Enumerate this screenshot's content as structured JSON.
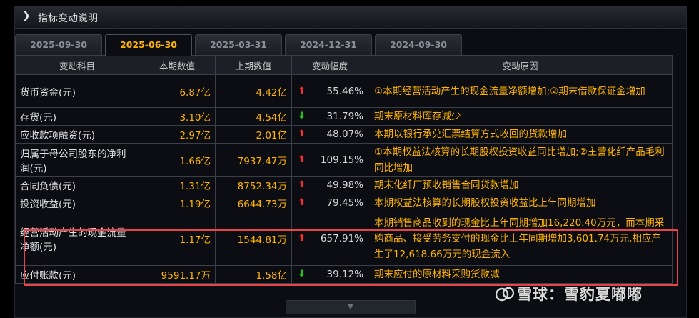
{
  "header": {
    "title": "指标变动说明"
  },
  "tabs": [
    {
      "label": "2025-09-30",
      "active": false
    },
    {
      "label": "2025-06-30",
      "active": true
    },
    {
      "label": "2025-03-31",
      "active": false
    },
    {
      "label": "2024-12-31",
      "active": false
    },
    {
      "label": "2024-09-30",
      "active": false
    }
  ],
  "columns": [
    "变动科目",
    "本期数值",
    "上期数值",
    "变动幅度",
    "变动原因"
  ],
  "rows": [
    {
      "item": "货币资金(元)",
      "cur_val": "6.87",
      "cur_unit": "亿",
      "prev_val": "4.42",
      "prev_unit": "亿",
      "change": "55.46%",
      "direction": "up",
      "reason": "①本期经营活动产生的现金流量净额增加;②期末借款保证金增加"
    },
    {
      "item": "存货(元)",
      "cur_val": "3.10",
      "cur_unit": "亿",
      "prev_val": "4.54",
      "prev_unit": "亿",
      "change": "31.79%",
      "direction": "down",
      "reason": "期末原材料库存减少"
    },
    {
      "item": "应收款项融资(元)",
      "cur_val": "2.97",
      "cur_unit": "亿",
      "prev_val": "2.01",
      "prev_unit": "亿",
      "change": "48.07%",
      "direction": "up",
      "reason": "本期以银行承兑汇票结算方式收回的货款增加"
    },
    {
      "item": "归属于母公司股东的净利润(元)",
      "cur_val": "1.66",
      "cur_unit": "亿",
      "prev_val": "7937.47",
      "prev_unit": "万",
      "change": "109.15%",
      "direction": "up",
      "reason": "①本期权益法核算的长期股权投资收益同比增加;②主营化纤产品毛利同比增加"
    },
    {
      "item": "合同负债(元)",
      "cur_val": "1.31",
      "cur_unit": "亿",
      "prev_val": "8752.34",
      "prev_unit": "万",
      "change": "49.98%",
      "direction": "up",
      "reason": "期末化纤厂预收销售合同货款增加"
    },
    {
      "item": "投资收益(元)",
      "cur_val": "1.19",
      "cur_unit": "亿",
      "prev_val": "6644.73",
      "prev_unit": "万",
      "change": "79.45%",
      "direction": "up",
      "reason": "本期权益法核算的长期股权投资收益比上年同期增加"
    },
    {
      "item": "经营活动产生的现金流量净额(元)",
      "cur_val": "1.17",
      "cur_unit": "亿",
      "prev_val": "1544.81",
      "prev_unit": "万",
      "change": "657.91%",
      "direction": "up",
      "reason": "本期销售商品收到的现金比上年同期增加16,220.40万元，而本期采购商品、接受劳务支付的现金比上年同期增加3,601.74万元,相应产生了12,618.66万元的现金流入"
    },
    {
      "item": "应付账款(元)",
      "cur_val": "9591.17",
      "cur_unit": "万",
      "prev_val": "1.58",
      "prev_unit": "亿",
      "change": "39.12%",
      "direction": "down",
      "reason": "期末应付的原材料采购货款减"
    }
  ],
  "watermark": {
    "text": "雪球：雪豹夏嘟嘟",
    "icon": "snowball-logo-icon"
  },
  "icons": {
    "header": "chevron-right-icon",
    "up": "arrow-up-icon",
    "down": "arrow-down-icon",
    "scroll": "chevron-down-icon"
  },
  "colors": {
    "accent": "#ffb400",
    "up": "#ff2e2e",
    "down": "#27c21b",
    "highlight_border": "#e8444a"
  }
}
